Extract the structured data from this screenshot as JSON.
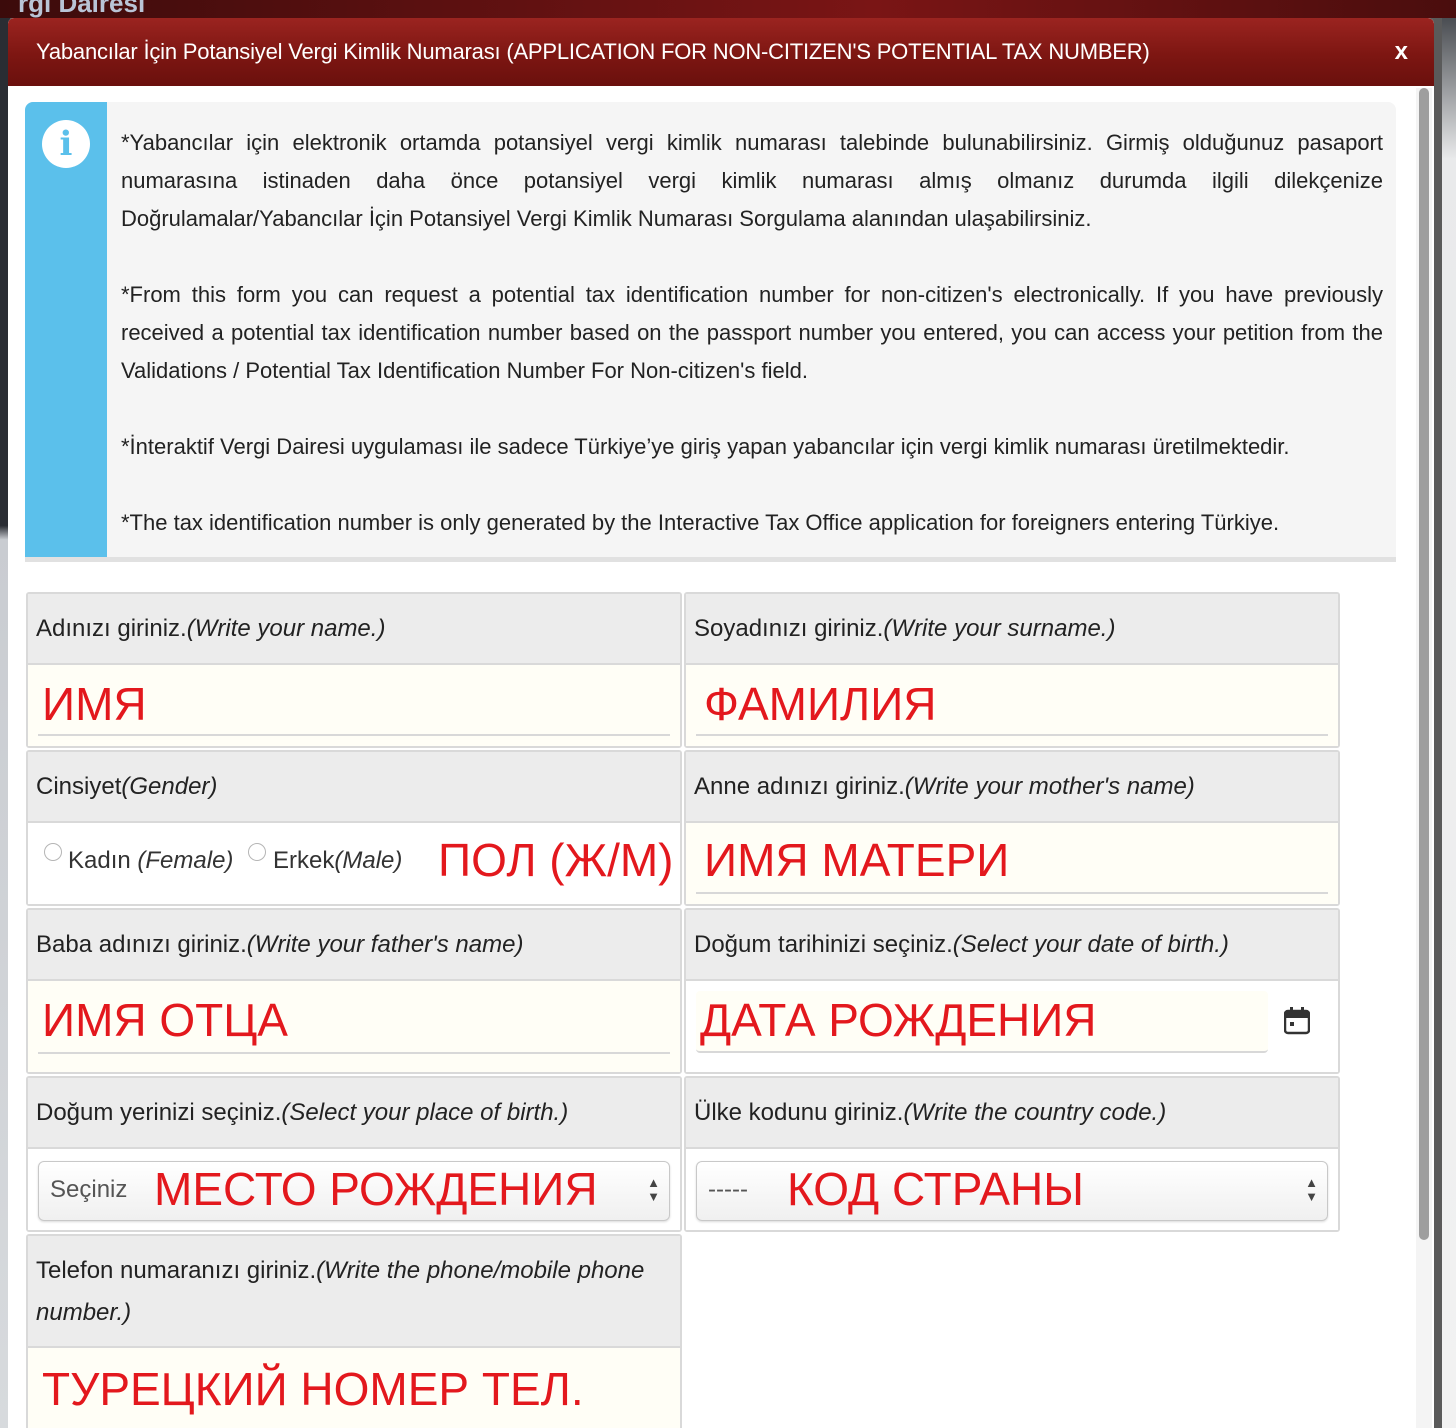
{
  "background": {
    "partial_text": "rgi Dairesi"
  },
  "modal": {
    "title": "Yabancılar İçin Potansiyel Vergi Kimlik Numarası (APPLICATION FOR NON-CITIZEN'S POTENTIAL TAX NUMBER)",
    "close_label": "x"
  },
  "info": {
    "icon": "info-icon",
    "paragraphs": [
      "*Yabancılar için elektronik ortamda potansiyel vergi kimlik numarası talebinde bulunabilirsiniz. Girmiş olduğunuz pasaport numarasına istinaden daha önce potansiyel vergi kimlik numarası almış olmanız durumda ilgili dilekçenize Doğrulamalar/Yabancılar İçin Potansiyel Vergi Kimlik Numarası Sorgulama alanından ulaşabilirsiniz.",
      "*From this form you can request a potential tax identification number for non-citizen's electronically. If you have previously received a potential tax identification number based on the passport number you entered, you can access your petition from the Validations / Potential Tax Identification Number For Non-citizen's field.",
      "*İnteraktif Vergi Dairesi uygulaması ile sadece Türkiye’ye giriş yapan yabancılar için vergi kimlik numarası üretilmektedir.",
      "*The tax identification number is only generated by the Interactive Tax Office application for foreigners entering Türkiye."
    ]
  },
  "form": {
    "name": {
      "label": "Adınızı giriniz.",
      "label_en": "(Write your name.)",
      "annotation": "ИМЯ"
    },
    "surname": {
      "label": "Soyadınızı giriniz.",
      "label_en": "(Write your surname.)",
      "annotation": "ФАМИЛИЯ"
    },
    "gender": {
      "label": "Cinsiyet ",
      "label_en": "(Gender)",
      "female": "Kadın ",
      "female_en": "(Female)",
      "male": "Erkek",
      "male_en": "(Male)",
      "annotation": "ПОЛ (Ж/М)"
    },
    "mother": {
      "label": "Anne adınızı giriniz. ",
      "label_en": "(Write your mother's name)",
      "annotation": "ИМЯ МАТЕРИ"
    },
    "father": {
      "label": "Baba adınızı giriniz. ",
      "label_en": "(Write your father's name)",
      "annotation": "ИМЯ ОТЦА"
    },
    "birthdate": {
      "label": "Doğum tarihinizi seçiniz. ",
      "label_en": "(Select your date of birth.)",
      "annotation": "ДАТА РОЖДЕНИЯ",
      "icon": "calendar-icon"
    },
    "birthplace": {
      "label": "Doğum yerinizi seçiniz.",
      "label_en": "(Select your place of birth.)",
      "selected": "Seçiniz",
      "annotation": "МЕСТО РОЖДЕНИЯ"
    },
    "country_code": {
      "label": "Ülke kodunu giriniz.",
      "label_en": "(Write the country code.)",
      "selected": "-----",
      "annotation": "КОД СТРАНЫ"
    },
    "phone": {
      "label": "Telefon numaranızı giriniz.",
      "label_en": "(Write the phone/mobile phone number.)",
      "annotation": "ТУРЕЦКИЙ НОМЕР ТЕЛ."
    }
  },
  "colors": {
    "header": "#7d1612",
    "info_accent": "#5bc0eb",
    "annotation_red": "#e3181d",
    "label_bg": "#ececec",
    "input_bg": "#fffef6"
  }
}
